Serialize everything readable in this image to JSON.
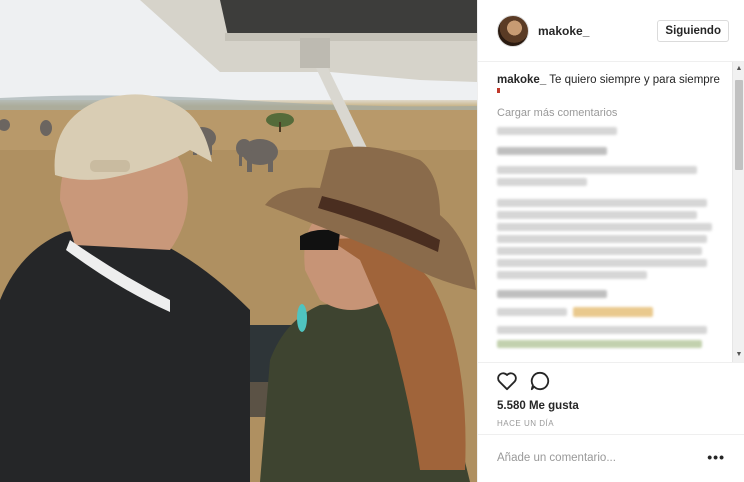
{
  "post": {
    "username": "makoke_",
    "follow_button": "Siguiendo",
    "caption_user": "makoke_",
    "caption_text": "Te quiero siempre y para siempre",
    "load_more": "Cargar más comentarios",
    "likes": "5.580 Me gusta",
    "time": "HACE UN DÍA",
    "comment_placeholder": "Añade un comentario...",
    "more_options": "•••"
  },
  "colors": {
    "accent_text": "#262626",
    "muted_text": "#999999",
    "border": "#efefef"
  },
  "icons": [
    "heart-icon",
    "comment-icon",
    "more-options-icon",
    "avatar"
  ]
}
